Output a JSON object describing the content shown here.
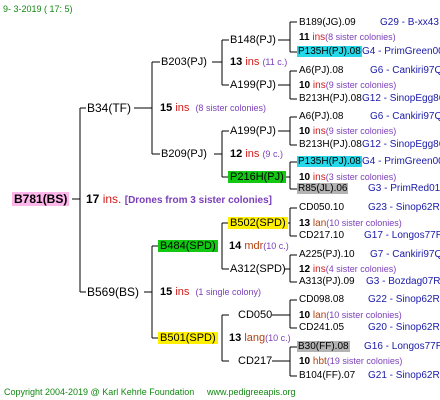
{
  "header": {
    "date": "9-  3-2019 (  17:   5)"
  },
  "footer": {
    "copyright": "Copyright 2004-2019 @ Karl Kehrle Foundation",
    "site": "www.pedigreeapis.org"
  },
  "root": {
    "id": "B781(BS)",
    "num": "17",
    "ins": "ins.",
    "note": "[Drones from 3 sister colonies]"
  },
  "gen1": [
    {
      "id": "B34(TF)",
      "num": "15",
      "ins": "ins",
      "note": "(8 sister colonies)"
    },
    {
      "id": "B569(BS)",
      "num": "15",
      "ins": "ins",
      "note": "(1 single colony)"
    }
  ],
  "gen2": [
    {
      "id": "B203(PJ)",
      "num": "13",
      "ins": "ins",
      "note": "(11 c.)"
    },
    {
      "id": "B209(PJ)",
      "num": "12",
      "ins": "ins",
      "note": "(9 c.)"
    },
    {
      "id": "B484(SPD)",
      "num": "14",
      "ins": "mdr",
      "note": "(10 c.)"
    },
    {
      "id": "B501(SPD)",
      "num": "13",
      "ins": "lang",
      "note": "(10 c.)"
    }
  ],
  "gen3": [
    {
      "id": "B148(PJ)",
      "num": "11",
      "ins": "ins",
      "note": "(8 sister colonies)"
    },
    {
      "id": "A199(PJ)",
      "num": "10",
      "ins": "ins",
      "note": "(9 sister colonies)"
    },
    {
      "id": "A199(PJ)",
      "num": "10",
      "ins": "ins",
      "note": "(9 sister colonies)"
    },
    {
      "id": "P216H(PJ)",
      "num": "10",
      "ins": "ins",
      "note": "(3 sister colonies)"
    },
    {
      "id": "B502(SPD)",
      "num": "13",
      "ins": "lan",
      "note": "(10 sister colonies)"
    },
    {
      "id": "A312(SPD)",
      "num": "12",
      "ins": "ins",
      "note": "(4 sister colonies)"
    },
    {
      "id": "CD050",
      "num": "10",
      "ins": "lan",
      "note": "(10 sister colonies)"
    },
    {
      "id": "CD217",
      "num": "10",
      "ins": "hbt",
      "note": "(19 sister colonies)"
    }
  ],
  "gen4": [
    {
      "id": "B189(JG).09",
      "code": "G29 - B-xx43"
    },
    {
      "id": "P135H(PJ).08",
      "code": "G4 - PrimGreen00"
    },
    {
      "id": "A6(PJ).08",
      "code": "G6 - Cankiri97Q"
    },
    {
      "id": "B213H(PJ).08",
      "code": "G12 - SinopEgg86R"
    },
    {
      "id": "A6(PJ).08",
      "code": "G6 - Cankiri97Q"
    },
    {
      "id": "B213H(PJ).08",
      "code": "G12 - SinopEgg86R"
    },
    {
      "id": "P135H(PJ).08",
      "code": "G4 - PrimGreen00"
    },
    {
      "id": "R85(JL).06",
      "code": "G3 - PrimRed01"
    },
    {
      "id": "CD050.10",
      "code": "G23 - Sinop62R"
    },
    {
      "id": "CD217.10",
      "code": "G17 - Longos77R"
    },
    {
      "id": "A225(PJ).10",
      "code": "G7 - Cankiri97Q"
    },
    {
      "id": "A313(PJ).09",
      "code": "G3 - Bozdag07R"
    },
    {
      "id": "CD098.08",
      "code": "G22 - Sinop62R"
    },
    {
      "id": "CD241.05",
      "code": "G20 - Sinop62R"
    },
    {
      "id": "B30(FF).08",
      "code": "G16 - Longos77R"
    },
    {
      "id": "B104(FF).07",
      "code": "G21 - Sinop62R"
    }
  ]
}
